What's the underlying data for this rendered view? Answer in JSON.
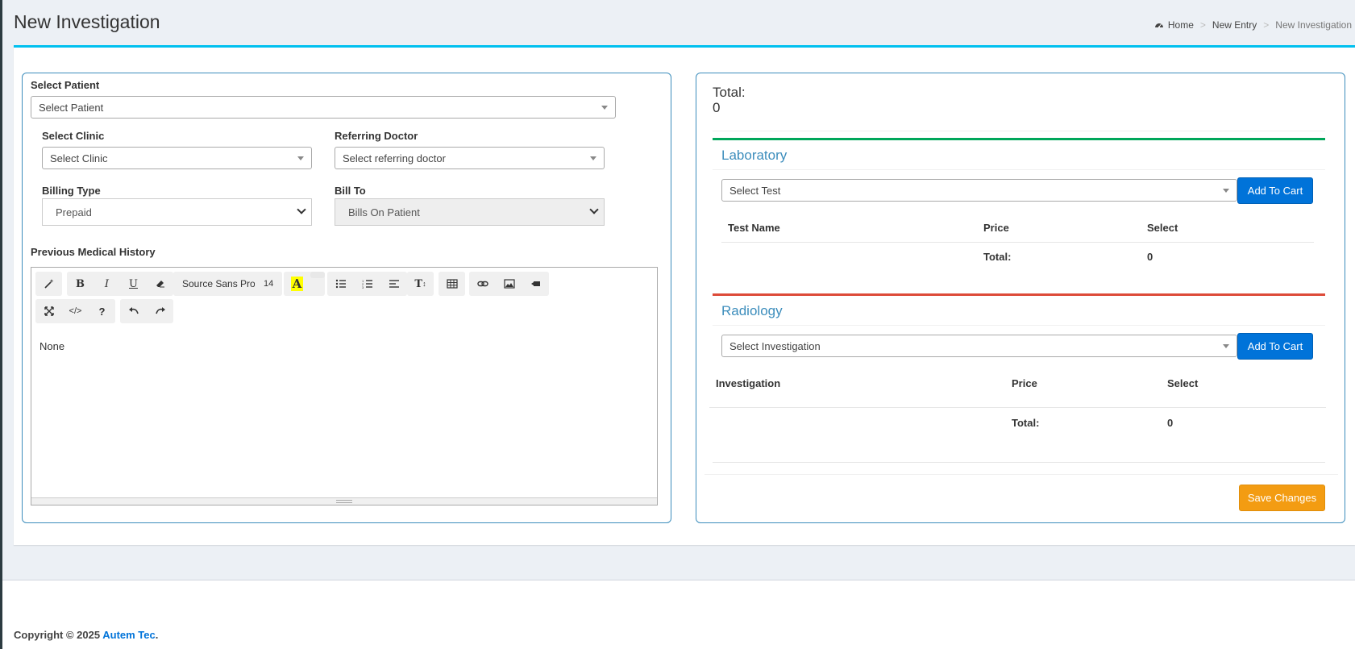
{
  "header": {
    "title": "New Investigation",
    "breadcrumb": {
      "home": "Home",
      "new_entry": "New Entry",
      "current": "New Investigation"
    }
  },
  "form": {
    "patient_label": "Select Patient",
    "patient_placeholder": "Select Patient",
    "clinic_label": "Select Clinic",
    "clinic_placeholder": "Select Clinic",
    "doctor_label": "Referring Doctor",
    "doctor_placeholder": "Select referring doctor",
    "billing_label": "Billing Type",
    "billing_value": "Prepaid",
    "billto_label": "Bill To",
    "billto_value": "Bills On Patient",
    "history_label": "Previous Medical History",
    "history_value": "None"
  },
  "editor_toolbar": {
    "font_name": "Source Sans Pro",
    "font_size": "14",
    "highlight_color": "#ffff00"
  },
  "summary": {
    "total_label": "Total:",
    "total_value": "0"
  },
  "laboratory": {
    "title": "Laboratory",
    "accent_color": "#00a65a",
    "select_placeholder": "Select Test",
    "add_button": "Add To Cart",
    "columns": [
      "Test Name",
      "Price",
      "Select"
    ],
    "total_label": "Total:",
    "total_value": "0"
  },
  "radiology": {
    "title": "Radiology",
    "accent_color": "#dd4b39",
    "select_placeholder": "Select Investigation",
    "add_button": "Add To Cart",
    "columns": [
      "Investigation",
      "Price",
      "Select"
    ],
    "total_label": "Total:",
    "total_value": "0"
  },
  "actions": {
    "save_label": "Save Changes"
  },
  "footer": {
    "copyright": "Copyright © 2025",
    "company": "Autem Tec",
    "suffix": "."
  }
}
